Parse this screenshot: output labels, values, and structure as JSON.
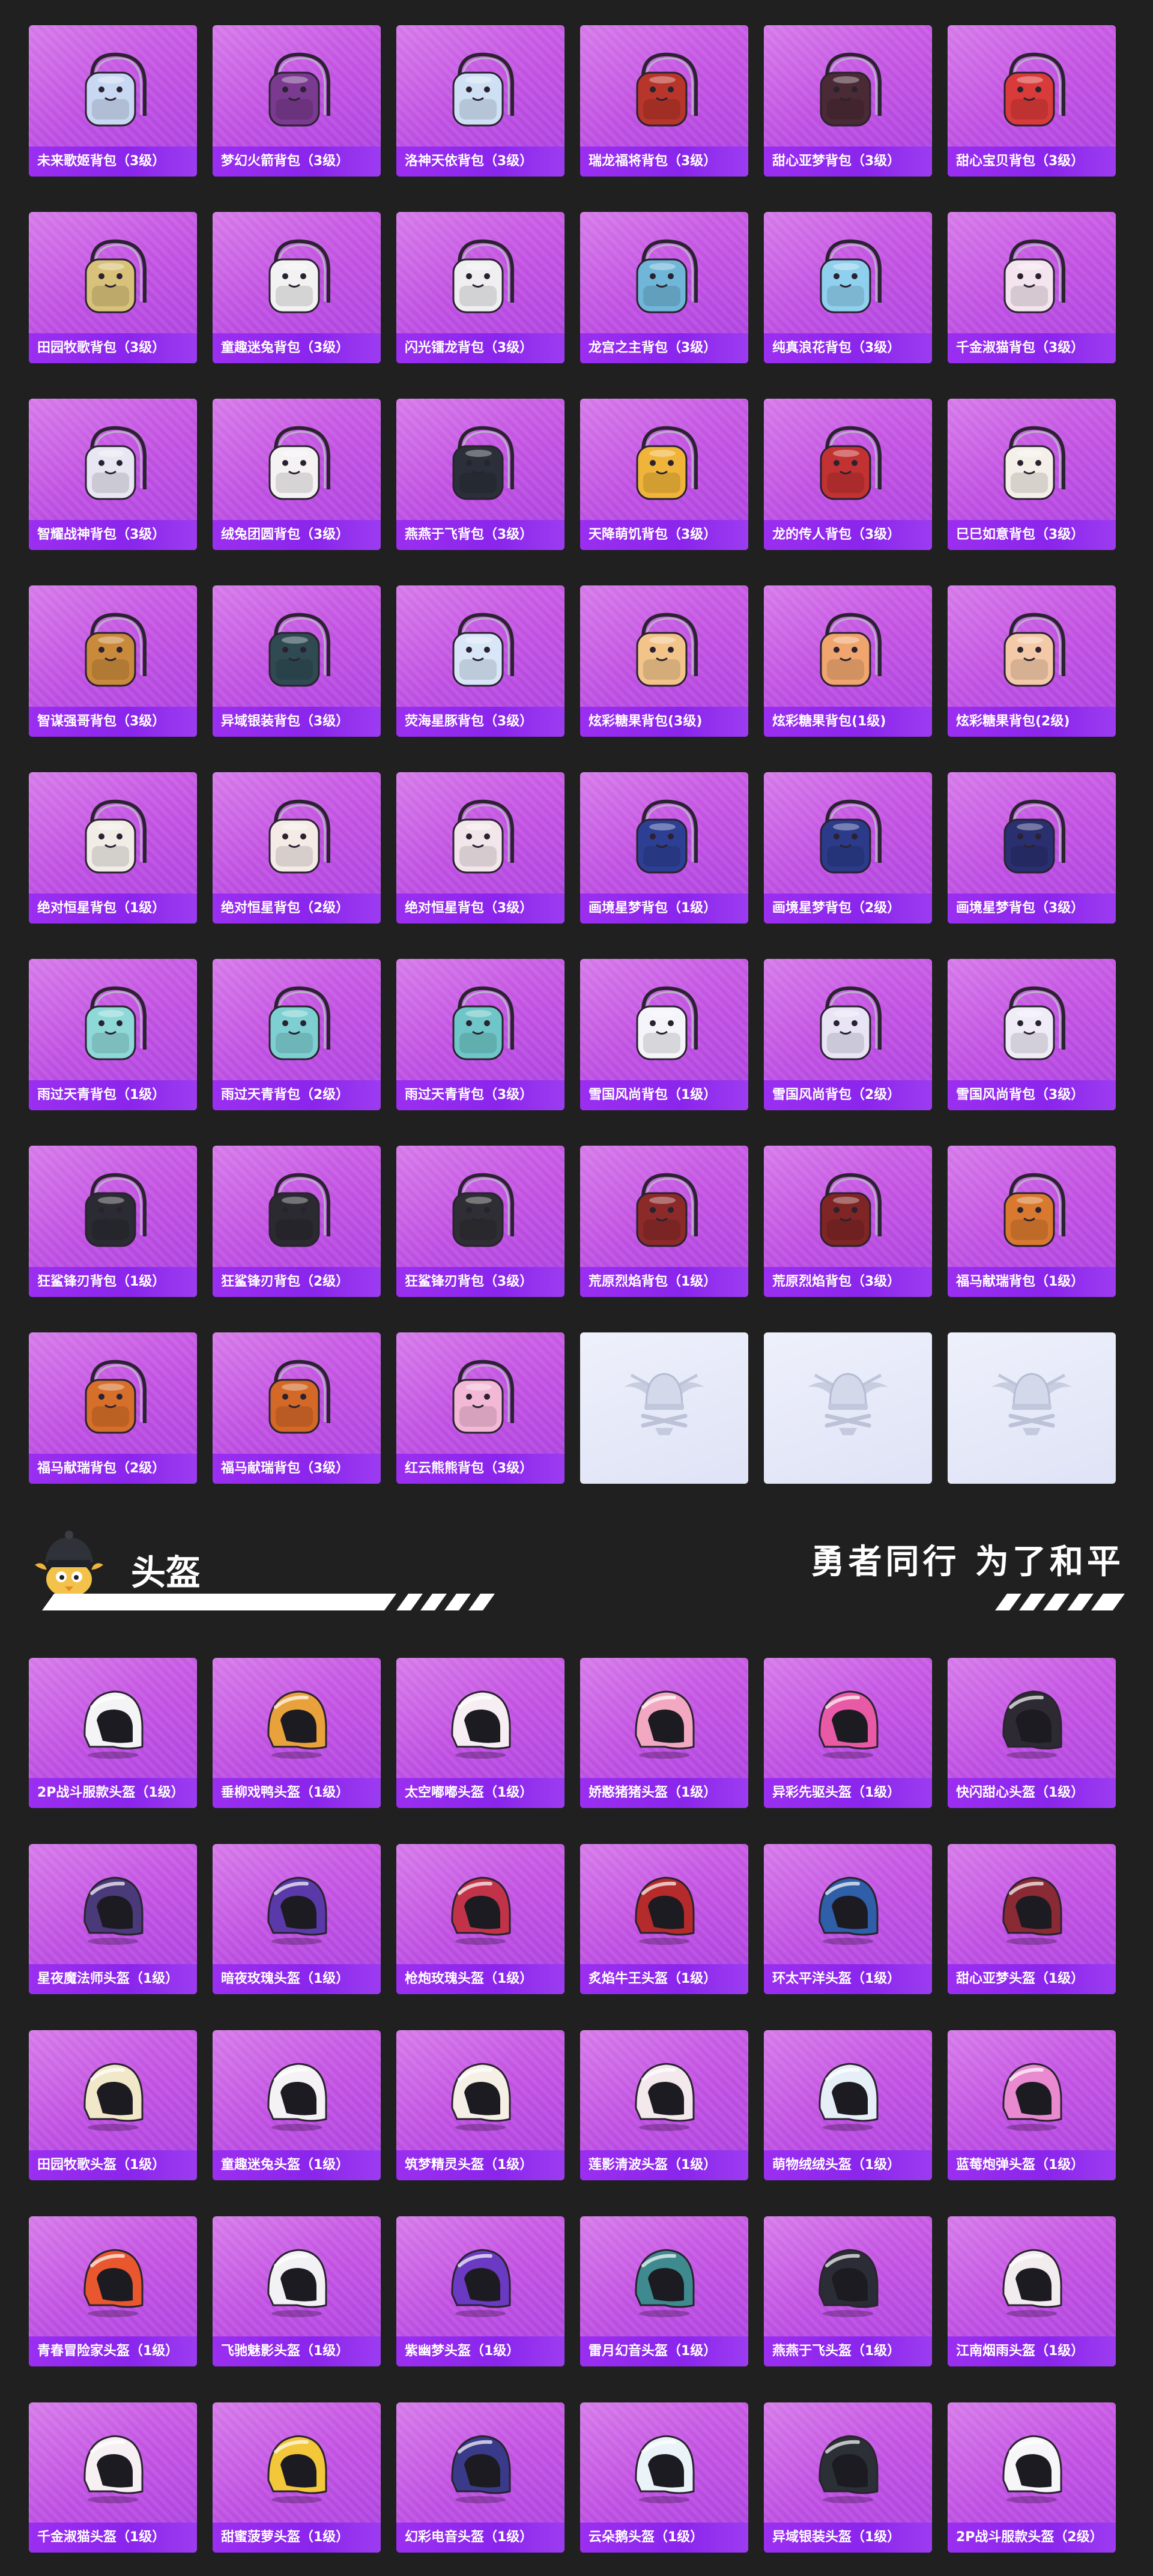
{
  "section": {
    "title": "头盔",
    "slogan": "勇者同行 为了和平"
  },
  "colors": {
    "page_bg": "#202020",
    "card_purple": "#c252e2",
    "label_purple": "#9b2ff0",
    "placeholder_bg": "#e4e7f7"
  },
  "backpacks": [
    {
      "label": "未来歌姬背包（3级）",
      "icon": "backpack-icon",
      "color": "#c9d8f2"
    },
    {
      "label": "梦幻火箭背包（3级）",
      "icon": "backpack-icon",
      "color": "#7a3a8f"
    },
    {
      "label": "洛神天依背包（3级）",
      "icon": "backpack-icon",
      "color": "#cfe0f5"
    },
    {
      "label": "瑞龙福将背包（3级）",
      "icon": "backpack-icon",
      "color": "#b8352b"
    },
    {
      "label": "甜心亚梦背包（3级）",
      "icon": "backpack-icon",
      "color": "#4a2a35"
    },
    {
      "label": "甜心宝贝背包（3级）",
      "icon": "backpack-icon",
      "color": "#d93a3a"
    },
    {
      "label": "田园牧歌背包（3级）",
      "icon": "backpack-icon",
      "color": "#d8c27a"
    },
    {
      "label": "童趣迷兔背包（3级）",
      "icon": "backpack-icon",
      "color": "#f2f2f2"
    },
    {
      "label": "闪光镭龙背包（3级）",
      "icon": "backpack-icon",
      "color": "#efeff2"
    },
    {
      "label": "龙宫之主背包（3级）",
      "icon": "backpack-icon",
      "color": "#6fb6d8"
    },
    {
      "label": "纯真浪花背包（3级）",
      "icon": "backpack-icon",
      "color": "#8fd0ee"
    },
    {
      "label": "千金淑猫背包（3级）",
      "icon": "backpack-icon",
      "color": "#f3e4ee"
    },
    {
      "label": "智耀战神背包（3级）",
      "icon": "backpack-icon",
      "color": "#e8e6f2"
    },
    {
      "label": "绒兔团圆背包（3级）",
      "icon": "backpack-icon",
      "color": "#f5f2f4"
    },
    {
      "label": "燕燕于飞背包（3级）",
      "icon": "backpack-icon",
      "color": "#2a2f3a"
    },
    {
      "label": "天降萌饥背包（3级）",
      "icon": "backpack-icon",
      "color": "#f0b43a"
    },
    {
      "label": "龙的传人背包（3级）",
      "icon": "backpack-icon",
      "color": "#c23232"
    },
    {
      "label": "巳巳如意背包（3级）",
      "icon": "backpack-icon",
      "color": "#f4efe8"
    },
    {
      "label": "智谋强哥背包（3级）",
      "icon": "backpack-icon",
      "color": "#c98a3c"
    },
    {
      "label": "异域银装背包（3级）",
      "icon": "backpack-icon",
      "color": "#2f4a52"
    },
    {
      "label": "荧海星豚背包（3级）",
      "icon": "backpack-icon",
      "color": "#d8e6f7"
    },
    {
      "label": "炫彩糖果背包(3级)",
      "icon": "backpack-icon",
      "color": "#f2c48a"
    },
    {
      "label": "炫彩糖果背包(1级)",
      "icon": "backpack-icon",
      "color": "#f0a56e"
    },
    {
      "label": "炫彩糖果背包(2级)",
      "icon": "backpack-icon",
      "color": "#f4c9a8"
    },
    {
      "label": "绝对恒星背包（1级）",
      "icon": "backpack-icon",
      "color": "#f1ece6"
    },
    {
      "label": "绝对恒星背包（2级）",
      "icon": "backpack-icon",
      "color": "#f4ebe6"
    },
    {
      "label": "绝对恒星背包（3级）",
      "icon": "backpack-icon",
      "color": "#f3e6ea"
    },
    {
      "label": "画境星梦背包（1级）",
      "icon": "backpack-icon",
      "color": "#2d3f93"
    },
    {
      "label": "画境星梦背包（2级）",
      "icon": "backpack-icon",
      "color": "#2b3b8a"
    },
    {
      "label": "画境星梦背包（3级）",
      "icon": "backpack-icon",
      "color": "#2a2f70"
    },
    {
      "label": "雨过天青背包（1级）",
      "icon": "backpack-icon",
      "color": "#8fd8d8"
    },
    {
      "label": "雨过天青背包（2级）",
      "icon": "backpack-icon",
      "color": "#7ecfd2"
    },
    {
      "label": "雨过天青背包（3级）",
      "icon": "backpack-icon",
      "color": "#6fc6c8"
    },
    {
      "label": "雪国风尚背包（1级）",
      "icon": "backpack-icon",
      "color": "#f4f4fa"
    },
    {
      "label": "雪国风尚背包（2级）",
      "icon": "backpack-icon",
      "color": "#e8e4f6"
    },
    {
      "label": "雪国风尚背包（3级）",
      "icon": "backpack-icon",
      "color": "#efecf7"
    },
    {
      "label": "狂鲨锋刃背包（1级）",
      "icon": "backpack-icon",
      "color": "#2b2b33"
    },
    {
      "label": "狂鲨锋刃背包（2级）",
      "icon": "backpack-icon",
      "color": "#2a2a30"
    },
    {
      "label": "狂鲨锋刃背包（3级）",
      "icon": "backpack-icon",
      "color": "#2f2e34"
    },
    {
      "label": "荒原烈焰背包（1级）",
      "icon": "backpack-icon",
      "color": "#8c2a2a"
    },
    {
      "label": "荒原烈焰背包（3级）",
      "icon": "backpack-icon",
      "color": "#7f2525"
    },
    {
      "label": "福马献瑞背包（1级）",
      "icon": "backpack-icon",
      "color": "#d9792f"
    },
    {
      "label": "福马献瑞背包（2级）",
      "icon": "backpack-icon",
      "color": "#d66f2a"
    },
    {
      "label": "福马献瑞背包（3级）",
      "icon": "backpack-icon",
      "color": "#d36827"
    },
    {
      "label": "红云熊熊背包（3级）",
      "icon": "backpack-icon",
      "color": "#f3b8d6"
    },
    {
      "label": "",
      "icon": "placeholder-emblem-icon",
      "color": "#cdd2e6",
      "placeholder": true
    },
    {
      "label": "",
      "icon": "placeholder-emblem-icon",
      "color": "#cdd2e6",
      "placeholder": true
    },
    {
      "label": "",
      "icon": "placeholder-emblem-icon",
      "color": "#cdd2e6",
      "placeholder": true
    }
  ],
  "helmets": [
    {
      "label": "2P战斗服款头盔（1级）",
      "icon": "helmet-icon",
      "color": "#f4f4f6"
    },
    {
      "label": "垂柳戏鸭头盔（1级）",
      "icon": "helmet-icon",
      "color": "#e9a23b"
    },
    {
      "label": "太空嘟嘟头盔（1级）",
      "icon": "helmet-icon",
      "color": "#f6eef2"
    },
    {
      "label": "娇憨猪猪头盔（1级）",
      "icon": "helmet-icon",
      "color": "#f3a8c2"
    },
    {
      "label": "异彩先驱头盔（1级）",
      "icon": "helmet-icon",
      "color": "#e85aa6"
    },
    {
      "label": "快闪甜心头盔（1级）",
      "icon": "helmet-icon",
      "color": "#2e2a33"
    },
    {
      "label": "星夜魔法师头盔（1级）",
      "icon": "helmet-icon",
      "color": "#4a3a7a"
    },
    {
      "label": "暗夜玫瑰头盔（1级）",
      "icon": "helmet-icon",
      "color": "#5a3aa8"
    },
    {
      "label": "枪炮玫瑰头盔（1级）",
      "icon": "helmet-icon",
      "color": "#c2334a"
    },
    {
      "label": "炙焰牛王头盔（1级）",
      "icon": "helmet-icon",
      "color": "#b52a2a"
    },
    {
      "label": "环太平洋头盔（1级）",
      "icon": "helmet-icon",
      "color": "#2f5fa8"
    },
    {
      "label": "甜心亚梦头盔（1级）",
      "icon": "helmet-icon",
      "color": "#8a2a34"
    },
    {
      "label": "田园牧歌头盔（1级）",
      "icon": "helmet-icon",
      "color": "#f0e8c8"
    },
    {
      "label": "童趣迷兔头盔（1级）",
      "icon": "helmet-icon",
      "color": "#f4f2f4"
    },
    {
      "label": "筑梦精灵头盔（1级）",
      "icon": "helmet-icon",
      "color": "#f5efe6"
    },
    {
      "label": "莲影清波头盔（1级）",
      "icon": "helmet-icon",
      "color": "#f3e8ec"
    },
    {
      "label": "萌物绒绒头盔（1级）",
      "icon": "helmet-icon",
      "color": "#e6eef8"
    },
    {
      "label": "蓝莓炮弹头盔（1级）",
      "icon": "helmet-icon",
      "color": "#e98ad0"
    },
    {
      "label": "青春冒险家头盔（1级）",
      "icon": "helmet-icon",
      "color": "#e9572f"
    },
    {
      "label": "飞驰魅影头盔（1级）",
      "icon": "helmet-icon",
      "color": "#f2f2f4"
    },
    {
      "label": "紫幽梦头盔（1级）",
      "icon": "helmet-icon",
      "color": "#6a3ac2"
    },
    {
      "label": "雷月幻音头盔（1级）",
      "icon": "helmet-icon",
      "color": "#3f8a8f"
    },
    {
      "label": "燕燕于飞头盔（1级）",
      "icon": "helmet-icon",
      "color": "#2a2d36"
    },
    {
      "label": "江南烟雨头盔（1级）",
      "icon": "helmet-icon",
      "color": "#f3ecef"
    },
    {
      "label": "千金淑猫头盔（1级）",
      "icon": "helmet-icon",
      "color": "#f7f0f3"
    },
    {
      "label": "甜蜜菠萝头盔（1级）",
      "icon": "helmet-icon",
      "color": "#f2c73a"
    },
    {
      "label": "幻彩电音头盔（1级）",
      "icon": "helmet-icon",
      "color": "#3a3a8a"
    },
    {
      "label": "云朵鹅头盔（1级）",
      "icon": "helmet-icon",
      "color": "#eaf3f8"
    },
    {
      "label": "异域银装头盔（1级）",
      "icon": "helmet-icon",
      "color": "#2a3036"
    },
    {
      "label": "2P战斗服款头盔（2级）",
      "icon": "helmet-icon",
      "color": "#f6f6f8"
    }
  ]
}
